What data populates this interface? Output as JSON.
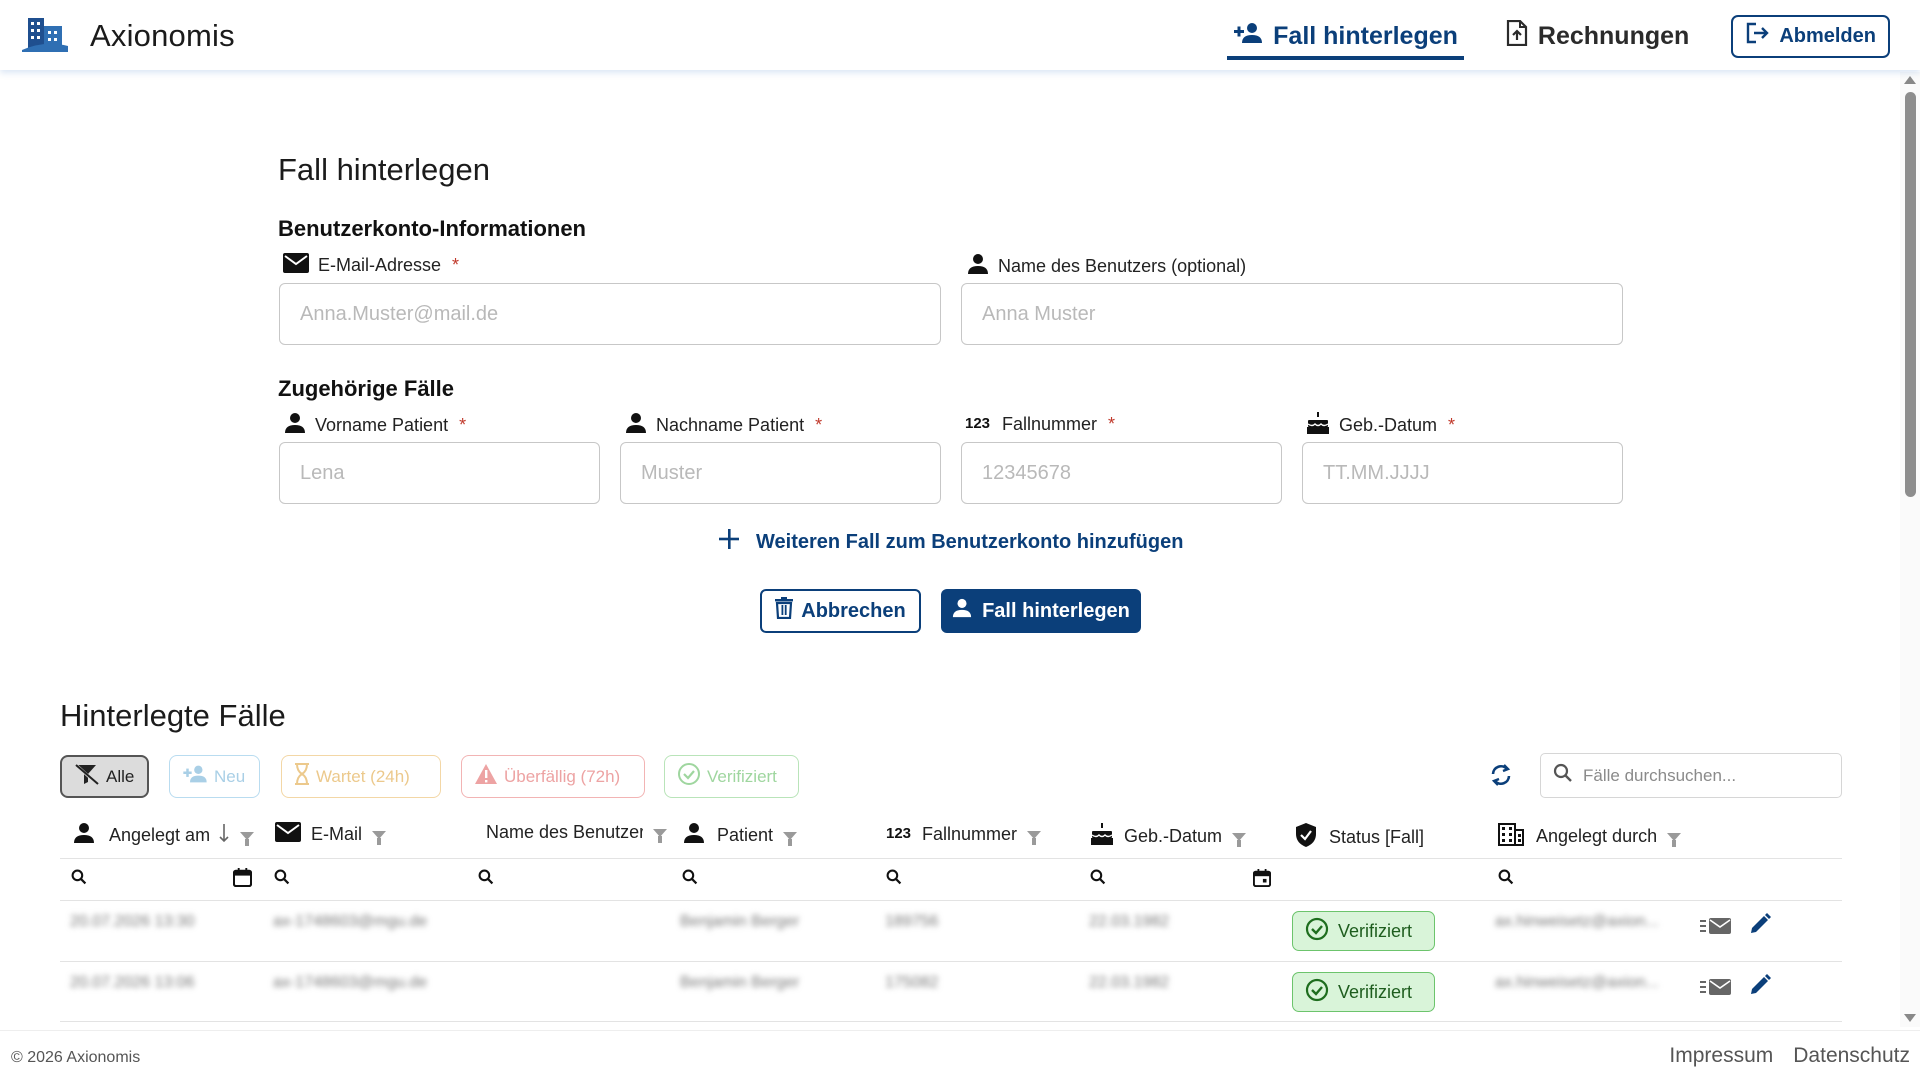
{
  "header": {
    "brand": "Axionomis",
    "nav_case": "Fall hinterlegen",
    "nav_invoices": "Rechnungen",
    "logout": "Abmelden"
  },
  "form": {
    "title": "Fall hinterlegen",
    "account_section": "Benutzerkonto-Informationen",
    "email_label": "E-Mail-Adresse",
    "email_placeholder": "Anna.Muster@mail.de",
    "username_label": "Name des Benutzers (optional)",
    "username_placeholder": "Anna Muster",
    "cases_section": "Zugehörige Fälle",
    "firstname_label": "Vorname Patient",
    "firstname_placeholder": "Lena",
    "lastname_label": "Nachname Patient",
    "lastname_placeholder": "Muster",
    "casenumber_label": "Fallnummer",
    "casenumber_placeholder": "12345678",
    "birthdate_label": "Geb.-Datum",
    "birthdate_placeholder": "TT.MM.JJJJ",
    "required_mark": "*",
    "add_case": "Weiteren Fall zum Benutzerkonto hinzufügen",
    "cancel": "Abbrechen",
    "submit": "Fall hinterlegen"
  },
  "cases": {
    "title": "Hinterlegte Fälle",
    "filters": {
      "all": "Alle",
      "new": "Neu",
      "waiting": "Wartet (24h)",
      "overdue": "Überfällig (72h)",
      "verified": "Verifiziert"
    },
    "search_placeholder": "Fälle durchsuchen...",
    "columns": {
      "created_at": "Angelegt am",
      "email": "E-Mail",
      "username": "Name des Benutzers",
      "patient": "Patient",
      "case_number": "Fallnummer",
      "birthdate": "Geb.-Datum",
      "status": "Status [Fall]",
      "created_by": "Angelegt durch"
    },
    "rows": [
      {
        "created_at": "20.07.2026 13:30",
        "email": "ax-1748603@mgu.de",
        "patient": "Benjamin Berger",
        "case_number": "189756",
        "birthdate": "22.03.1982",
        "status": "Verifiziert",
        "created_by": "ax.hinweisetz@axion..."
      },
      {
        "created_at": "20.07.2026 13:06",
        "email": "ax-1748603@mgu.de",
        "patient": "Benjamin Berger",
        "case_number": "175082",
        "birthdate": "22.03.1982",
        "status": "Verifiziert",
        "created_by": "ax.hinweisetz@axion..."
      }
    ]
  },
  "footer": {
    "copyright": "© 2026 Axionomis",
    "imprint": "Impressum",
    "privacy": "Datenschutz"
  },
  "colors": {
    "primary": "#0b3f7a",
    "required": "#c0392b",
    "verified_bg": "#d9f4d9",
    "verified_border": "#6cc46c"
  }
}
